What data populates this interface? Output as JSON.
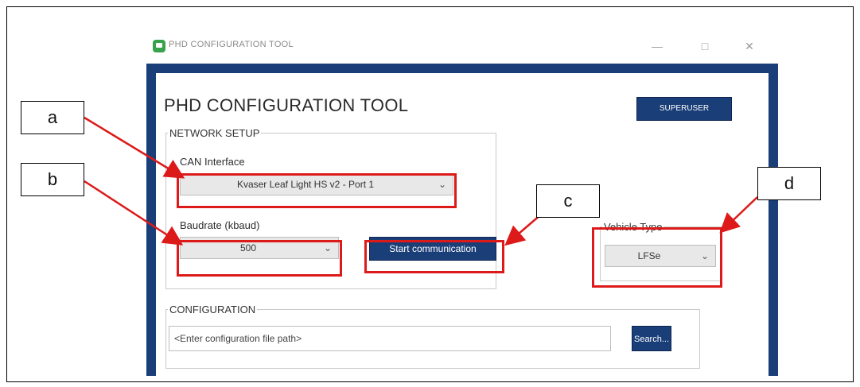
{
  "titlebar": {
    "title": "PHD CONFIGURATION TOOL",
    "minimize": "—",
    "maximize": "□",
    "close": "✕"
  },
  "main": {
    "title": "PHD CONFIGURATION TOOL",
    "superuser_label": "SUPERUSER"
  },
  "network_setup": {
    "legend": "NETWORK SETUP",
    "can_interface_label": "CAN Interface",
    "can_interface_value": "Kvaser Leaf Light HS v2 - Port 1",
    "baudrate_label": "Baudrate (kbaud)",
    "baudrate_value": "500",
    "start_button": "Start communication"
  },
  "vehicle": {
    "legend": "Vehicle Type",
    "value": "LFSe"
  },
  "configuration": {
    "legend": "CONFIGURATION",
    "path_placeholder": "<Enter configuration file path>",
    "search_button": "Search..."
  },
  "callouts": {
    "a": "a",
    "b": "b",
    "c": "c",
    "d": "d"
  },
  "icons": {
    "app": "bus-icon",
    "dropdown": "chevron-down-icon"
  },
  "colors": {
    "window_frame": "#1a3e78",
    "highlight": "#dd1a1a",
    "app_icon": "#37a24a"
  }
}
